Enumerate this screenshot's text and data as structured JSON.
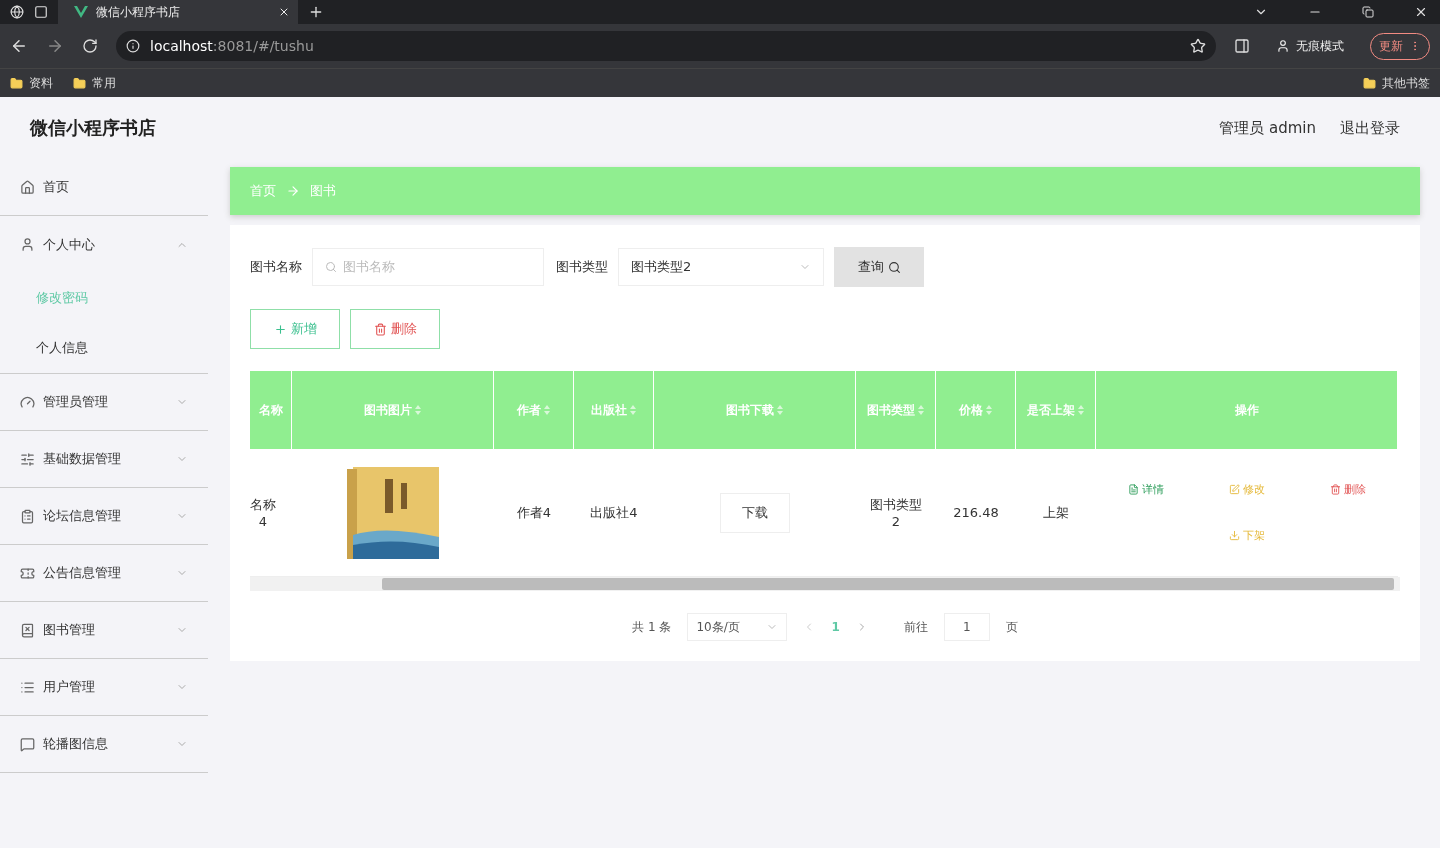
{
  "browser": {
    "tab_title": "微信小程序书店",
    "url_host": "localhost",
    "url_rest": ":8081/#/tushu",
    "profile": "无痕模式",
    "update": "更新",
    "bookmarks": [
      "资料",
      "常用"
    ],
    "other_bookmarks": "其他书签"
  },
  "header": {
    "title": "微信小程序书店",
    "user": "管理员 admin",
    "logout": "退出登录"
  },
  "sidebar": {
    "items": [
      {
        "label": "首页",
        "kind": "link"
      },
      {
        "label": "个人中心",
        "kind": "group",
        "expanded": true,
        "children": [
          {
            "label": "修改密码",
            "selected": true
          },
          {
            "label": "个人信息",
            "selected": false
          }
        ]
      },
      {
        "label": "管理员管理",
        "kind": "group",
        "expanded": false
      },
      {
        "label": "基础数据管理",
        "kind": "group",
        "expanded": false
      },
      {
        "label": "论坛信息管理",
        "kind": "group",
        "expanded": false
      },
      {
        "label": "公告信息管理",
        "kind": "group",
        "expanded": false
      },
      {
        "label": "图书管理",
        "kind": "group",
        "expanded": false
      },
      {
        "label": "用户管理",
        "kind": "group",
        "expanded": false
      },
      {
        "label": "轮播图信息",
        "kind": "group",
        "expanded": false
      }
    ]
  },
  "breadcrumb": [
    "首页",
    "图书"
  ],
  "search": {
    "name_label": "图书名称",
    "name_placeholder": "图书名称",
    "type_label": "图书类型",
    "type_value": "图书类型2",
    "button": "查询"
  },
  "actions": [
    {
      "kind": "add",
      "label": "新增"
    },
    {
      "kind": "delete",
      "label": "删除"
    }
  ],
  "table": {
    "columns": [
      {
        "label": "名称",
        "sortable": false
      },
      {
        "label": "图书图片",
        "sortable": true
      },
      {
        "label": "作者",
        "sortable": true
      },
      {
        "label": "出版社",
        "sortable": true
      },
      {
        "label": "图书下载",
        "sortable": true
      },
      {
        "label": "图书类型",
        "sortable": true
      },
      {
        "label": "价格",
        "sortable": true
      },
      {
        "label": "是否上架",
        "sortable": true
      },
      {
        "label": "操作",
        "sortable": false
      }
    ],
    "rows": [
      {
        "name": [
          "名称",
          "4"
        ],
        "author": "作者4",
        "publisher": "出版社4",
        "download": "下载",
        "type": [
          "图书类型",
          "2"
        ],
        "price": "216.48",
        "status": "上架",
        "operations": [
          {
            "kind": "detail",
            "label": "详情"
          },
          {
            "kind": "edit",
            "label": "修改"
          },
          {
            "kind": "delete",
            "label": "删除"
          },
          {
            "kind": "offshelf",
            "label": "下架"
          }
        ]
      }
    ]
  },
  "pagination": {
    "total": "共 1 条",
    "page_size": "10条/页",
    "pages": [
      {
        "label": "1",
        "selected": true
      }
    ],
    "goto_label": "前往",
    "goto_value": "1",
    "page_unit": "页"
  }
}
